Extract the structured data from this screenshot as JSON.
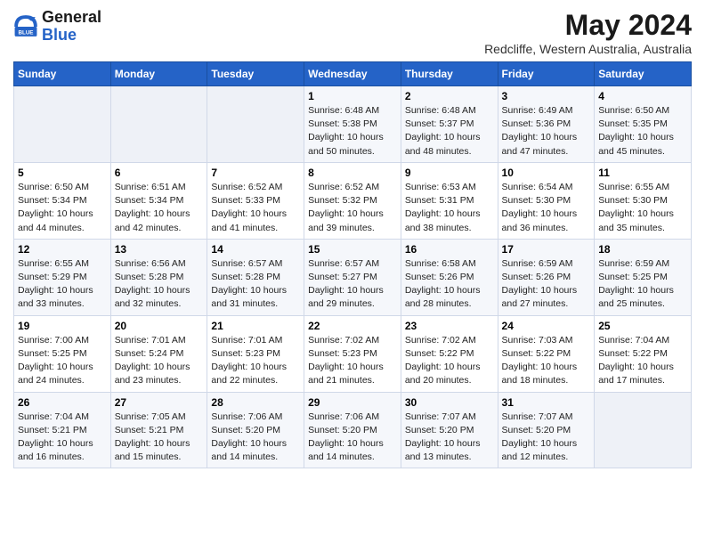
{
  "header": {
    "logo_line1": "General",
    "logo_line2": "Blue",
    "title": "May 2024",
    "subtitle": "Redcliffe, Western Australia, Australia"
  },
  "days_of_week": [
    "Sunday",
    "Monday",
    "Tuesday",
    "Wednesday",
    "Thursday",
    "Friday",
    "Saturday"
  ],
  "weeks": [
    [
      {
        "day": "",
        "info": ""
      },
      {
        "day": "",
        "info": ""
      },
      {
        "day": "",
        "info": ""
      },
      {
        "day": "1",
        "info": "Sunrise: 6:48 AM\nSunset: 5:38 PM\nDaylight: 10 hours\nand 50 minutes."
      },
      {
        "day": "2",
        "info": "Sunrise: 6:48 AM\nSunset: 5:37 PM\nDaylight: 10 hours\nand 48 minutes."
      },
      {
        "day": "3",
        "info": "Sunrise: 6:49 AM\nSunset: 5:36 PM\nDaylight: 10 hours\nand 47 minutes."
      },
      {
        "day": "4",
        "info": "Sunrise: 6:50 AM\nSunset: 5:35 PM\nDaylight: 10 hours\nand 45 minutes."
      }
    ],
    [
      {
        "day": "5",
        "info": "Sunrise: 6:50 AM\nSunset: 5:34 PM\nDaylight: 10 hours\nand 44 minutes."
      },
      {
        "day": "6",
        "info": "Sunrise: 6:51 AM\nSunset: 5:34 PM\nDaylight: 10 hours\nand 42 minutes."
      },
      {
        "day": "7",
        "info": "Sunrise: 6:52 AM\nSunset: 5:33 PM\nDaylight: 10 hours\nand 41 minutes."
      },
      {
        "day": "8",
        "info": "Sunrise: 6:52 AM\nSunset: 5:32 PM\nDaylight: 10 hours\nand 39 minutes."
      },
      {
        "day": "9",
        "info": "Sunrise: 6:53 AM\nSunset: 5:31 PM\nDaylight: 10 hours\nand 38 minutes."
      },
      {
        "day": "10",
        "info": "Sunrise: 6:54 AM\nSunset: 5:30 PM\nDaylight: 10 hours\nand 36 minutes."
      },
      {
        "day": "11",
        "info": "Sunrise: 6:55 AM\nSunset: 5:30 PM\nDaylight: 10 hours\nand 35 minutes."
      }
    ],
    [
      {
        "day": "12",
        "info": "Sunrise: 6:55 AM\nSunset: 5:29 PM\nDaylight: 10 hours\nand 33 minutes."
      },
      {
        "day": "13",
        "info": "Sunrise: 6:56 AM\nSunset: 5:28 PM\nDaylight: 10 hours\nand 32 minutes."
      },
      {
        "day": "14",
        "info": "Sunrise: 6:57 AM\nSunset: 5:28 PM\nDaylight: 10 hours\nand 31 minutes."
      },
      {
        "day": "15",
        "info": "Sunrise: 6:57 AM\nSunset: 5:27 PM\nDaylight: 10 hours\nand 29 minutes."
      },
      {
        "day": "16",
        "info": "Sunrise: 6:58 AM\nSunset: 5:26 PM\nDaylight: 10 hours\nand 28 minutes."
      },
      {
        "day": "17",
        "info": "Sunrise: 6:59 AM\nSunset: 5:26 PM\nDaylight: 10 hours\nand 27 minutes."
      },
      {
        "day": "18",
        "info": "Sunrise: 6:59 AM\nSunset: 5:25 PM\nDaylight: 10 hours\nand 25 minutes."
      }
    ],
    [
      {
        "day": "19",
        "info": "Sunrise: 7:00 AM\nSunset: 5:25 PM\nDaylight: 10 hours\nand 24 minutes."
      },
      {
        "day": "20",
        "info": "Sunrise: 7:01 AM\nSunset: 5:24 PM\nDaylight: 10 hours\nand 23 minutes."
      },
      {
        "day": "21",
        "info": "Sunrise: 7:01 AM\nSunset: 5:23 PM\nDaylight: 10 hours\nand 22 minutes."
      },
      {
        "day": "22",
        "info": "Sunrise: 7:02 AM\nSunset: 5:23 PM\nDaylight: 10 hours\nand 21 minutes."
      },
      {
        "day": "23",
        "info": "Sunrise: 7:02 AM\nSunset: 5:22 PM\nDaylight: 10 hours\nand 20 minutes."
      },
      {
        "day": "24",
        "info": "Sunrise: 7:03 AM\nSunset: 5:22 PM\nDaylight: 10 hours\nand 18 minutes."
      },
      {
        "day": "25",
        "info": "Sunrise: 7:04 AM\nSunset: 5:22 PM\nDaylight: 10 hours\nand 17 minutes."
      }
    ],
    [
      {
        "day": "26",
        "info": "Sunrise: 7:04 AM\nSunset: 5:21 PM\nDaylight: 10 hours\nand 16 minutes."
      },
      {
        "day": "27",
        "info": "Sunrise: 7:05 AM\nSunset: 5:21 PM\nDaylight: 10 hours\nand 15 minutes."
      },
      {
        "day": "28",
        "info": "Sunrise: 7:06 AM\nSunset: 5:20 PM\nDaylight: 10 hours\nand 14 minutes."
      },
      {
        "day": "29",
        "info": "Sunrise: 7:06 AM\nSunset: 5:20 PM\nDaylight: 10 hours\nand 14 minutes."
      },
      {
        "day": "30",
        "info": "Sunrise: 7:07 AM\nSunset: 5:20 PM\nDaylight: 10 hours\nand 13 minutes."
      },
      {
        "day": "31",
        "info": "Sunrise: 7:07 AM\nSunset: 5:20 PM\nDaylight: 10 hours\nand 12 minutes."
      },
      {
        "day": "",
        "info": ""
      }
    ]
  ]
}
